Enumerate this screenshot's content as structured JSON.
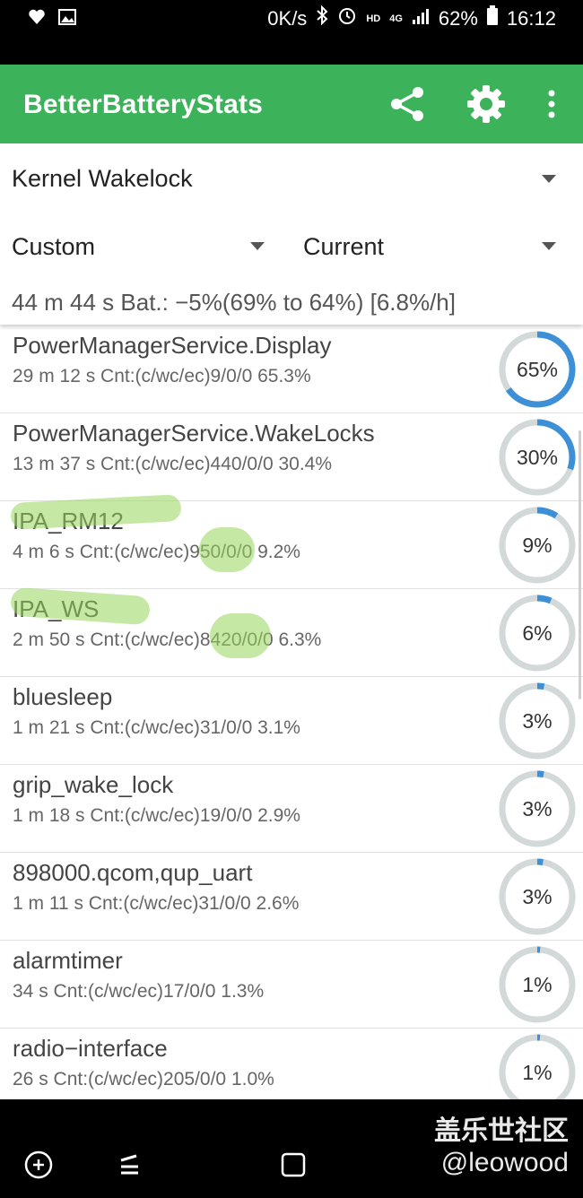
{
  "status_bar": {
    "speed": "0K/s",
    "hd": "HD",
    "network": "4G",
    "battery_percent": "62%",
    "time": "16:12"
  },
  "app_bar": {
    "title": "BetterBatteryStats",
    "icons": [
      "share-icon",
      "settings-icon",
      "overflow-menu-icon"
    ]
  },
  "filters": {
    "stat_type": "Kernel Wakelock",
    "reference_from": "Custom",
    "reference_to": "Current",
    "summary": "44 m 44 s  Bat.: −5%(69% to 64%) [6.8%/h]"
  },
  "colors": {
    "accent": "#3cb35a",
    "ring_fill": "#3d8fd6",
    "ring_track": "#d3d9d9"
  },
  "wakelocks": [
    {
      "name": "PowerManagerService.Display",
      "detail": "29 m 12 s  Cnt:(c/wc/ec)9/0/0 65.3%",
      "percent_label": "65%",
      "fraction": 0.653
    },
    {
      "name": "PowerManagerService.WakeLocks",
      "detail": "13 m 37 s  Cnt:(c/wc/ec)440/0/0 30.4%",
      "percent_label": "30%",
      "fraction": 0.304
    },
    {
      "name": "IPA_RM12",
      "detail": "4 m 6 s  Cnt:(c/wc/ec)950/0/0 9.2%",
      "percent_label": "9%",
      "fraction": 0.092
    },
    {
      "name": "IPA_WS",
      "detail": "2 m 50 s  Cnt:(c/wc/ec)8420/0/0 6.3%",
      "percent_label": "6%",
      "fraction": 0.063
    },
    {
      "name": "bluesleep",
      "detail": "1 m 21 s  Cnt:(c/wc/ec)31/0/0 3.1%",
      "percent_label": "3%",
      "fraction": 0.031
    },
    {
      "name": "grip_wake_lock",
      "detail": "1 m 18 s  Cnt:(c/wc/ec)19/0/0 2.9%",
      "percent_label": "3%",
      "fraction": 0.029
    },
    {
      "name": "898000.qcom,qup_uart",
      "detail": "1 m 11 s  Cnt:(c/wc/ec)31/0/0 2.6%",
      "percent_label": "3%",
      "fraction": 0.026
    },
    {
      "name": "alarmtimer",
      "detail": "34 s  Cnt:(c/wc/ec)17/0/0 1.3%",
      "percent_label": "1%",
      "fraction": 0.013
    },
    {
      "name": "radio−interface",
      "detail": "26 s  Cnt:(c/wc/ec)205/0/0 1.0%",
      "percent_label": "1%",
      "fraction": 0.01
    }
  ],
  "watermark": {
    "line1": "盖乐世社区",
    "line2": "@leowood"
  },
  "nav_bar": {
    "icons": [
      "game-launcher-icon",
      "recents-icon",
      "home-icon",
      "back-icon"
    ]
  }
}
